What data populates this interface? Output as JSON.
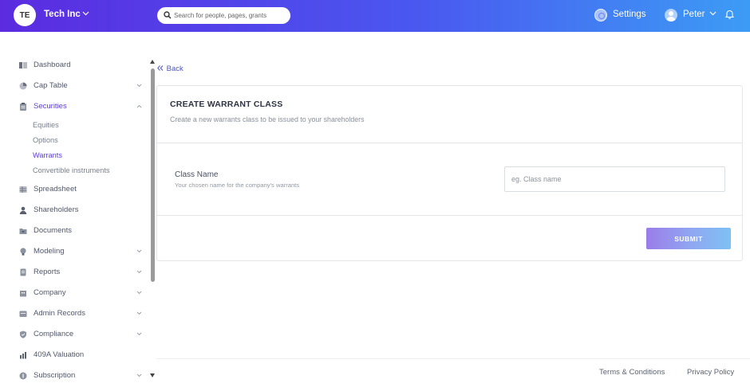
{
  "header": {
    "logo_initials": "TE",
    "company_name": "Tech Inc",
    "search_placeholder": "Search for people, pages, grants",
    "settings_label": "Settings",
    "user_name": "Peter"
  },
  "sidebar": {
    "items": [
      {
        "label": "Dashboard"
      },
      {
        "label": "Cap Table"
      },
      {
        "label": "Securities"
      },
      {
        "label": "Spreadsheet"
      },
      {
        "label": "Shareholders"
      },
      {
        "label": "Documents"
      },
      {
        "label": "Modeling"
      },
      {
        "label": "Reports"
      },
      {
        "label": "Company"
      },
      {
        "label": "Admin Records"
      },
      {
        "label": "Compliance"
      },
      {
        "label": "409A Valuation"
      },
      {
        "label": "Subscription"
      }
    ],
    "securities_sub": [
      "Equities",
      "Options",
      "Warrants",
      "Convertible instruments"
    ],
    "active_color": "#5b3ed6"
  },
  "main": {
    "back_label": "Back",
    "card_title": "CREATE WARRANT CLASS",
    "card_subtitle": "Create a new warrants class to be issued to your shareholders",
    "field_label": "Class Name",
    "field_help": "Your chosen name for the company's warrants",
    "field_placeholder": "eg. Class name",
    "field_value": "",
    "submit_label": "SUBMIT"
  },
  "footer": {
    "terms": "Terms & Conditions",
    "privacy": "Privacy Policy"
  }
}
